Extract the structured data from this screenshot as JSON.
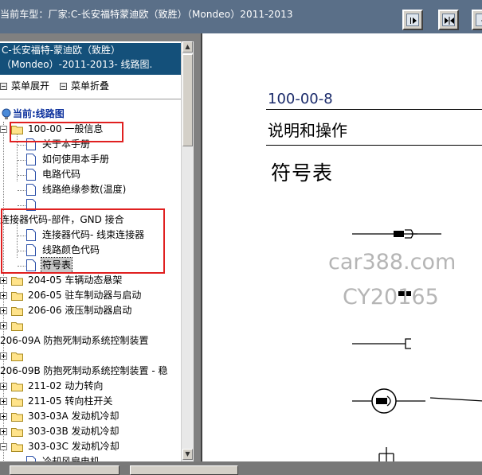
{
  "topbar": {
    "title": "当前车型：厂家:C-长安福特蒙迪欧（致胜）（Mondeo）2011-2013",
    "buttons": [
      {
        "icon": "arrow-right-icon"
      },
      {
        "icon": "arrows-inward-icon"
      },
      {
        "icon": "arrow-left-icon"
      }
    ]
  },
  "sidebar": {
    "header_line1": "C-长安福特-蒙迪欧（致胜）",
    "header_line2": "（Mondeo）-2011-2013- 线路图.",
    "expand_label": "菜单展开",
    "collapse_label": "菜单折叠",
    "current_label": "当前:线路图",
    "tree": [
      {
        "label": "100-00 一般信息",
        "type": "folder",
        "state": "open"
      },
      {
        "label": "关于本手册",
        "type": "doc"
      },
      {
        "label": "如何使用本手册",
        "type": "doc"
      },
      {
        "label": "电路代码",
        "type": "doc"
      },
      {
        "label": "线路绝缘参数(温度)",
        "type": "doc"
      },
      {
        "label": "",
        "type": "doc"
      },
      {
        "label": "连接器代码-部件，GND 接合",
        "type": "text"
      },
      {
        "label": "连接器代码- 线束连接器",
        "type": "doc"
      },
      {
        "label": "线路颜色代码",
        "type": "doc"
      },
      {
        "label": "符号表",
        "type": "doc",
        "selected": true
      },
      {
        "label": "204-05 车辆动态悬架",
        "type": "folder"
      },
      {
        "label": "206-05 驻车制动器与启动",
        "type": "folder"
      },
      {
        "label": "206-06 液压制动器启动",
        "type": "folder"
      },
      {
        "label": "",
        "type": "folder"
      },
      {
        "label": "206-09A 防抱死制动系统控制装置",
        "type": "text"
      },
      {
        "label": "",
        "type": "folder"
      },
      {
        "label": "206-09B 防抱死制动系统控制装置 - 稳",
        "type": "text"
      },
      {
        "label": "211-02 动力转向",
        "type": "folder"
      },
      {
        "label": "211-05 转向柱开关",
        "type": "folder"
      },
      {
        "label": "303-03A 发动机冷却",
        "type": "folder"
      },
      {
        "label": "303-03B 发动机冷却",
        "type": "folder"
      },
      {
        "label": "303-03C 发动机冷却",
        "type": "folder"
      },
      {
        "label": "冷却风扇电机",
        "type": "doc"
      }
    ]
  },
  "document": {
    "code": "100-00-8",
    "subtitle": "说明和操作",
    "title": "符号表"
  },
  "watermark": {
    "line1": "car388.com",
    "line2": "CY20165"
  }
}
